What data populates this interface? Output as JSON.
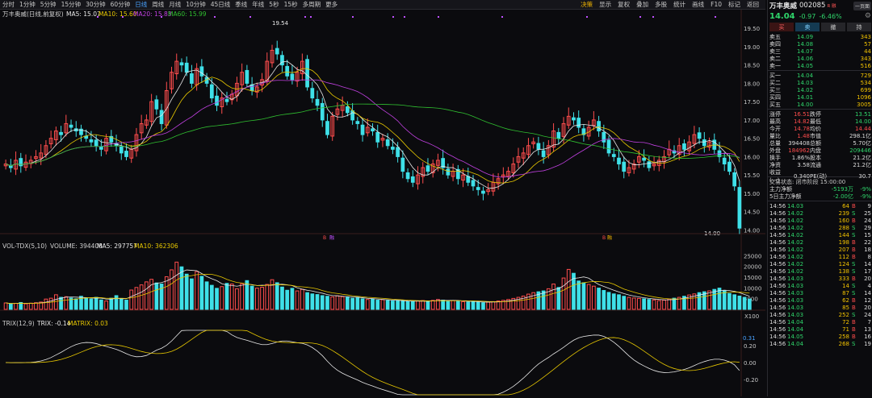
{
  "periods": [
    "分时",
    "1分钟",
    "5分钟",
    "15分钟",
    "30分钟",
    "60分钟",
    "日线",
    "周线",
    "月线",
    "10分钟",
    "45日线",
    "季线",
    "年线",
    "5秒",
    "15秒",
    "多周期",
    "更多"
  ],
  "active_period": "日线",
  "toolbar": [
    "决策",
    "显示",
    "复权",
    "叠加",
    "多股",
    "统计",
    "画线",
    "F10",
    "标记",
    "返回"
  ],
  "chart_header": {
    "title": "万丰奥威(日线,前复权)",
    "ma5": "MA5: 15.07",
    "ma10": "MA10: 15.60",
    "ma20": "MA20: 15.83",
    "ma60": "MA60: 15.99"
  },
  "vol_header": {
    "title": "VOL-TDX(5,10)",
    "volume": "VOLUME: 394408",
    "ma5": "MA5: 297757",
    "ma10": "MA10: 362306"
  },
  "trix_header": {
    "title": "TRIX(12,9)",
    "trix": "TRIX: -0.14",
    "matrix": "MATRIX: 0.03"
  },
  "annotations": {
    "high": "19.54",
    "low": "14.00",
    "x100": "X100",
    "trix_mark": "0.31",
    "m1": "B",
    "m2": "融",
    "m3": "B",
    "m4": "融"
  },
  "price_axis": [
    "19.50",
    "19.00",
    "18.50",
    "18.00",
    "17.50",
    "17.00",
    "16.50",
    "16.00",
    "15.50",
    "15.00",
    "14.50",
    "14.00"
  ],
  "vol_axis": [
    "25000",
    "20000",
    "15000",
    "10000",
    "5000"
  ],
  "trix_axis": [
    "0.20",
    "0.00",
    "-0.20"
  ],
  "colors": {
    "up": "#ff4d4d",
    "down": "#3fe0e8",
    "ma5": "#e8e8e8",
    "ma10": "#e8c800",
    "ma20": "#c040e0",
    "ma60": "#30c030"
  },
  "stock": {
    "name": "万丰奥威",
    "code": "002085",
    "badge": "R 融",
    "price": "14.04",
    "change": "-0.97",
    "pct": "-6.46%",
    "menu": "一页面"
  },
  "trade_buttons": {
    "buy": "买",
    "sell": "卖",
    "cancel": "撤",
    "hold": "持"
  },
  "asks": [
    {
      "l": "卖五",
      "p": "14.09",
      "q": "343"
    },
    {
      "l": "卖四",
      "p": "14.08",
      "q": "57"
    },
    {
      "l": "卖三",
      "p": "14.07",
      "q": "44"
    },
    {
      "l": "卖二",
      "p": "14.06",
      "q": "343"
    },
    {
      "l": "卖一",
      "p": "14.05",
      "q": "516"
    }
  ],
  "bids": [
    {
      "l": "买一",
      "p": "14.04",
      "q": "729"
    },
    {
      "l": "买二",
      "p": "14.03",
      "q": "534"
    },
    {
      "l": "买三",
      "p": "14.02",
      "q": "699"
    },
    {
      "l": "买四",
      "p": "14.01",
      "q": "1096"
    },
    {
      "l": "买五",
      "p": "14.00",
      "q": "3005"
    }
  ],
  "stats": [
    {
      "k1": "涨停",
      "v1": "16.51",
      "k2": "跌停",
      "v2": "13.51"
    },
    {
      "k1": "最高",
      "v1": "14.82",
      "k2": "最低",
      "v2": "14.00"
    },
    {
      "k1": "今开",
      "v1": "14.78",
      "k2": "均价",
      "v2": "14.44"
    },
    {
      "k1": "量比",
      "v1": "1.48",
      "k2": "市值",
      "v2": "298.1亿"
    },
    {
      "k1": "总量",
      "v1": "394408",
      "k2": "总额",
      "v2": "5.70亿"
    },
    {
      "k1": "外盘",
      "v1": "184962",
      "k2": "内盘",
      "v2": "209446"
    },
    {
      "k1": "换手",
      "v1": "1.86%",
      "k2": "股本",
      "v2": "21.2亿"
    },
    {
      "k1": "净资",
      "v1": "3.58",
      "k2": "流通",
      "v2": "21.2亿"
    },
    {
      "k1": "收益(一)",
      "v1": "0.340",
      "k2": "PE(动)",
      "v2": "30.7"
    }
  ],
  "trade_status": "交易状态: 闭市阶段 15:00:00",
  "flows": [
    {
      "k": "主力净额",
      "v": "-5193万",
      "p": "-9%"
    },
    {
      "k": "5日主力净额",
      "v": "-2.00亿",
      "p": "-9%"
    }
  ],
  "ticks": [
    {
      "t": "14:56",
      "p": "14.03",
      "q": "64",
      "s": "B",
      "n": "9"
    },
    {
      "t": "14:56",
      "p": "14.02",
      "q": "239",
      "s": "S",
      "n": "25"
    },
    {
      "t": "14:56",
      "p": "14.02",
      "q": "160",
      "s": "B",
      "n": "24"
    },
    {
      "t": "14:56",
      "p": "14.02",
      "q": "288",
      "s": "S",
      "n": "29"
    },
    {
      "t": "14:56",
      "p": "14.02",
      "q": "144",
      "s": "S",
      "n": "15"
    },
    {
      "t": "14:56",
      "p": "14.02",
      "q": "198",
      "s": "B",
      "n": "22"
    },
    {
      "t": "14:56",
      "p": "14.02",
      "q": "207",
      "s": "B",
      "n": "18"
    },
    {
      "t": "14:56",
      "p": "14.02",
      "q": "112",
      "s": "B",
      "n": "8"
    },
    {
      "t": "14:56",
      "p": "14.02",
      "q": "124",
      "s": "S",
      "n": "14"
    },
    {
      "t": "14:56",
      "p": "14.02",
      "q": "138",
      "s": "S",
      "n": "17"
    },
    {
      "t": "14:56",
      "p": "14.03",
      "q": "333",
      "s": "B",
      "n": "20"
    },
    {
      "t": "14:56",
      "p": "14.03",
      "q": "14",
      "s": "S",
      "n": "4"
    },
    {
      "t": "14:56",
      "p": "14.03",
      "q": "87",
      "s": "S",
      "n": "14"
    },
    {
      "t": "14:56",
      "p": "14.03",
      "q": "62",
      "s": "B",
      "n": "12"
    },
    {
      "t": "14:56",
      "p": "14.03",
      "q": "85",
      "s": "B",
      "n": "20"
    },
    {
      "t": "14:56",
      "p": "14.03",
      "q": "252",
      "s": "S",
      "n": "24"
    },
    {
      "t": "14:56",
      "p": "14.04",
      "q": "72",
      "s": "B",
      "n": "7"
    },
    {
      "t": "14:56",
      "p": "14.04",
      "q": "71",
      "s": "B",
      "n": "13"
    },
    {
      "t": "14:56",
      "p": "14.05",
      "q": "258",
      "s": "B",
      "n": "16"
    },
    {
      "t": "14:56",
      "p": "14.04",
      "q": "268",
      "s": "S",
      "n": "19"
    }
  ],
  "chart_data": {
    "type": "candlestick",
    "title": "万丰奥威(日线,前复权)",
    "ylim": [
      13.9,
      19.7
    ],
    "closes": [
      15.8,
      15.7,
      15.9,
      15.75,
      15.85,
      15.9,
      16.0,
      16.1,
      16.3,
      16.5,
      16.7,
      16.6,
      16.9,
      16.8,
      16.7,
      16.6,
      16.5,
      16.4,
      16.3,
      16.2,
      16.5,
      16.4,
      16.3,
      16.1,
      16.0,
      16.2,
      16.6,
      16.9,
      17.0,
      17.5,
      17.3,
      16.9,
      17.8,
      18.3,
      18.6,
      18.5,
      18.3,
      18.0,
      18.4,
      18.2,
      18.0,
      17.6,
      17.4,
      17.6,
      17.5,
      17.7,
      18.0,
      18.3,
      18.0,
      17.8,
      17.9,
      18.1,
      18.6,
      18.9,
      18.8,
      18.5,
      18.2,
      18.1,
      18.3,
      18.6,
      17.9,
      17.6,
      17.4,
      17.0,
      16.6,
      17.1,
      17.3,
      17.4,
      17.2,
      17.0,
      16.9,
      16.6,
      16.8,
      16.7,
      16.4,
      16.5,
      16.3,
      16.2,
      16.0,
      15.6,
      15.4,
      15.3,
      15.5,
      15.7,
      15.6,
      15.8,
      15.9,
      15.7,
      15.5,
      15.6,
      15.4,
      15.5,
      15.3,
      15.2,
      15.1,
      15.0,
      15.1,
      15.3,
      15.4,
      15.5,
      15.6,
      15.8,
      16.0,
      16.1,
      16.3,
      16.4,
      16.2,
      16.0,
      16.3,
      16.7,
      16.5,
      16.9,
      17.1,
      17.0,
      16.8,
      16.6,
      16.8,
      17.0,
      16.7,
      16.4,
      16.1,
      16.0,
      15.8,
      15.6,
      15.7,
      15.8,
      16.0,
      15.9,
      15.7,
      15.8,
      15.9,
      16.0,
      16.2,
      16.1,
      16.3,
      16.2,
      16.4,
      16.6,
      16.5,
      16.3,
      16.4,
      16.2,
      16.0,
      15.8,
      15.6,
      15.2,
      14.05
    ],
    "volumes": [
      3000,
      2500,
      2800,
      3200,
      2600,
      2900,
      3100,
      3400,
      4800,
      5200,
      6800,
      5600,
      5900,
      5300,
      4900,
      6100,
      5200,
      4800,
      5600,
      4400,
      3900,
      5200,
      6400,
      5100,
      4300,
      9000,
      10200,
      11400,
      12800,
      14000,
      12300,
      11800,
      15200,
      18400,
      22000,
      19800,
      16400,
      14200,
      17600,
      15400,
      12800,
      11200,
      9800,
      10600,
      12100,
      11800,
      9600,
      11900,
      13400,
      10800,
      9900,
      10300,
      11600,
      13800,
      12400,
      10400,
      8900,
      9800,
      8600,
      9300,
      7800,
      7200,
      6900,
      6400,
      6100,
      5800,
      6300,
      5900,
      5600,
      5200,
      5500,
      4900,
      4600,
      4800,
      4300,
      4500,
      4100,
      3900,
      4200,
      3800,
      3600,
      3700,
      3900,
      4100,
      3800,
      4200,
      4600,
      4300,
      3900,
      4100,
      3800,
      3600,
      3400,
      3800,
      3300,
      3100,
      3400,
      3600,
      3900,
      4200,
      4600,
      5100,
      5600,
      6200,
      7100,
      7800,
      8200,
      8600,
      9600,
      11800,
      10200,
      14600,
      18600,
      16800,
      13200,
      12400,
      11600,
      10800,
      9900,
      8800,
      7900,
      7200,
      6800,
      6100,
      5600,
      5300,
      5100,
      4900,
      4600,
      4400,
      4100,
      4300,
      4800,
      5200,
      5600,
      6100,
      6700,
      7200,
      7800,
      8200,
      8600,
      9300,
      9900,
      8600,
      7400,
      6800,
      6200,
      5600,
      4800
    ]
  }
}
